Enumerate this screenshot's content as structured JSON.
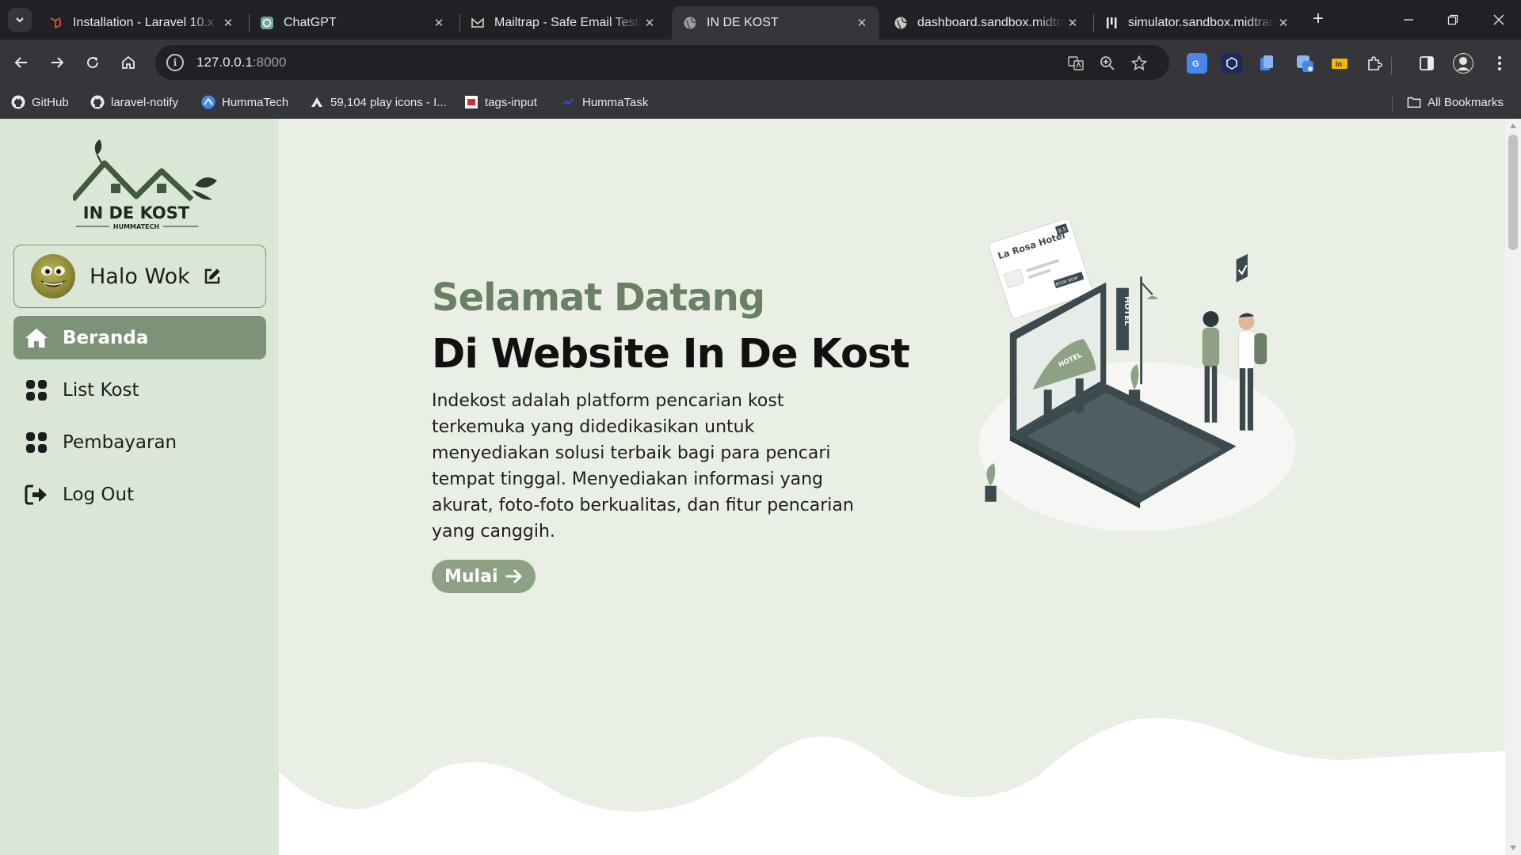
{
  "browser": {
    "tabs": [
      {
        "title": "Installation - Laravel 10.x -",
        "icon": "laravel-icon",
        "active": false
      },
      {
        "title": "ChatGPT",
        "icon": "chatgpt-icon",
        "active": false
      },
      {
        "title": "Mailtrap - Safe Email Testin",
        "icon": "mailtrap-icon",
        "active": false
      },
      {
        "title": "IN DE KOST",
        "icon": "globe-icon",
        "active": true
      },
      {
        "title": "dashboard.sandbox.midtra",
        "icon": "globe-icon",
        "active": false
      },
      {
        "title": "simulator.sandbox.midtran",
        "icon": "midtrans-icon",
        "active": false
      }
    ],
    "url": {
      "host": "127.0.0.1",
      "port": ":8000"
    },
    "bookmarks": [
      {
        "label": "GitHub",
        "icon": "github-icon"
      },
      {
        "label": "laravel-notify",
        "icon": "github-icon"
      },
      {
        "label": "HummaTech",
        "icon": "hummatech-icon"
      },
      {
        "label": "59,104 play icons - I...",
        "icon": "flaticon-icon"
      },
      {
        "label": "tags-input",
        "icon": "tags-icon"
      },
      {
        "label": "HummaTask",
        "icon": "hummatask-icon"
      }
    ],
    "all_bookmarks_label": "All Bookmarks"
  },
  "sidebar": {
    "logo": {
      "name": "IN DE KOST",
      "tagline": "HUMMATECH"
    },
    "profile_name": "Halo Wok",
    "menu": [
      {
        "label": "Beranda",
        "icon": "home-icon",
        "active": true
      },
      {
        "label": "List Kost",
        "icon": "grid-icon",
        "active": false
      },
      {
        "label": "Pembayaran",
        "icon": "grid-icon",
        "active": false
      },
      {
        "label": "Log Out",
        "icon": "logout-icon",
        "active": false
      }
    ]
  },
  "hero": {
    "subtitle": "Selamat Datang",
    "title": "Di Website In De Kost",
    "description": "Indekost adalah platform pencarian kost terkemuka yang didedikasikan untuk menyediakan solusi terbaik bagi para pencari tempat tinggal. Menyediakan informasi yang akurat, foto-foto berkualitas, dan fitur pencarian yang canggih.",
    "cta_label": "Mulai"
  },
  "illustration": {
    "card_title": "La Rosa Hotel",
    "card_rating": "8.5",
    "card_button": "BOOK NOW",
    "sign": "HOTEL",
    "awning": "HOTEL"
  },
  "colors": {
    "accent": "#7d9276",
    "sidebar_bg": "#dbe7d6",
    "main_bg": "#e9efe5",
    "subtitle": "#6a8064"
  }
}
